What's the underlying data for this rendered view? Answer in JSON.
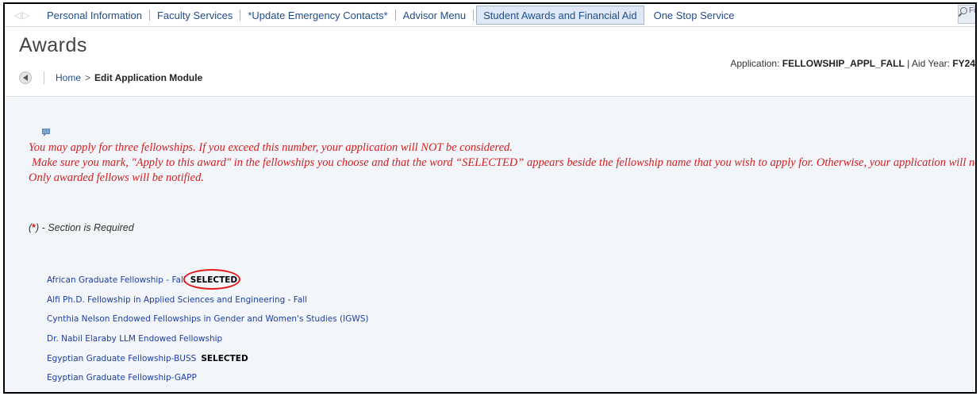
{
  "nav": {
    "items": [
      {
        "label": "Personal Information",
        "active": false
      },
      {
        "label": "Faculty Services",
        "active": false
      },
      {
        "label": "*Update Emergency Contacts*",
        "active": false
      },
      {
        "label": "Advisor Menu",
        "active": false
      },
      {
        "label": "Student Awards and Financial Aid",
        "active": true
      },
      {
        "label": "One Stop Service",
        "active": false
      }
    ],
    "find_label": "Fin"
  },
  "page": {
    "title": "Awards",
    "app_label": "Application:",
    "app_value": "FELLOWSHIP_APPL_FALL",
    "aid_year_label": "| Aid Year:",
    "aid_year_value": "FY24"
  },
  "breadcrumb": {
    "home": "Home",
    "separator": ">",
    "current": "Edit Application Module"
  },
  "notice": {
    "line1": "You may apply for three fellowships. If you exceed this number, your application will NOT be considered.",
    "line2": "Make sure you mark, \"Apply to this award\" in the fellowships you choose and that the word “SELECTED” appears beside the fellowship name that you wish to apply for. Otherwise, your application will not be recognizable.",
    "line3": "Only awarded fellows will be notified."
  },
  "required": {
    "open": "(",
    "star": "*",
    "close": ") - Section is Required"
  },
  "fellowships": [
    {
      "name": "African Graduate Fellowship - Fall",
      "status": "SELECTED",
      "circled": true
    },
    {
      "name": "Alfi Ph.D. Fellowship in Applied Sciences and Engineering - Fall",
      "status": ""
    },
    {
      "name": "Cynthia Nelson Endowed Fellowships in Gender and Women's Studies (IGWS)",
      "status": ""
    },
    {
      "name": "Dr. Nabil Elaraby LLM Endowed Fellowship",
      "status": ""
    },
    {
      "name": "Egyptian Graduate Fellowship-BUSS",
      "status": "SELECTED"
    },
    {
      "name": "Egyptian Graduate Fellowship-GAPP",
      "status": ""
    }
  ],
  "colors": {
    "notice_red": "#d32020",
    "link_blue": "#1f3ea8",
    "nav_blue": "#1f4e8c",
    "panel_bg": "#f2f5f9"
  }
}
